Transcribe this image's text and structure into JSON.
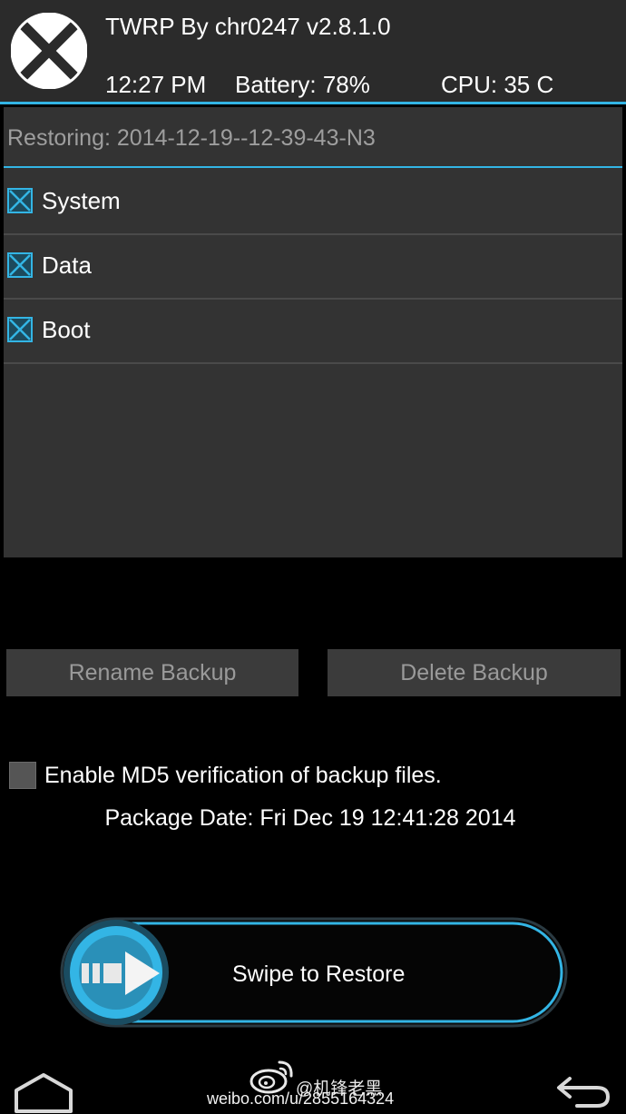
{
  "header": {
    "title": "TWRP By chr0247  v2.8.1.0",
    "time": "12:27 PM",
    "battery": "Battery: 78%",
    "cpu": "CPU: 35 C",
    "logo_icon": "twrp-logo-icon"
  },
  "restore": {
    "title": "Restoring: 2014-12-19--12-39-43-N3",
    "partitions": [
      {
        "label": "System",
        "checked": true
      },
      {
        "label": "Data",
        "checked": true
      },
      {
        "label": "Boot",
        "checked": true
      }
    ]
  },
  "buttons": {
    "rename": "Rename Backup",
    "delete": "Delete Backup"
  },
  "md5": {
    "label": "Enable MD5 verification of backup files.",
    "checked": false
  },
  "package_date": "Package Date: Fri Dec 19 12:41:28 2014",
  "swipe": {
    "label": "Swipe to Restore"
  },
  "navbar": {
    "home_icon": "home-icon",
    "back_icon": "back-icon"
  },
  "watermark": {
    "name": "@机锋老黑",
    "url": "weibo.com/u/2855164324"
  },
  "colors": {
    "accent": "#33b5e5",
    "header_bg": "#2b2b2b",
    "panel_bg": "#333333",
    "button_bg": "#3b3b3b"
  }
}
